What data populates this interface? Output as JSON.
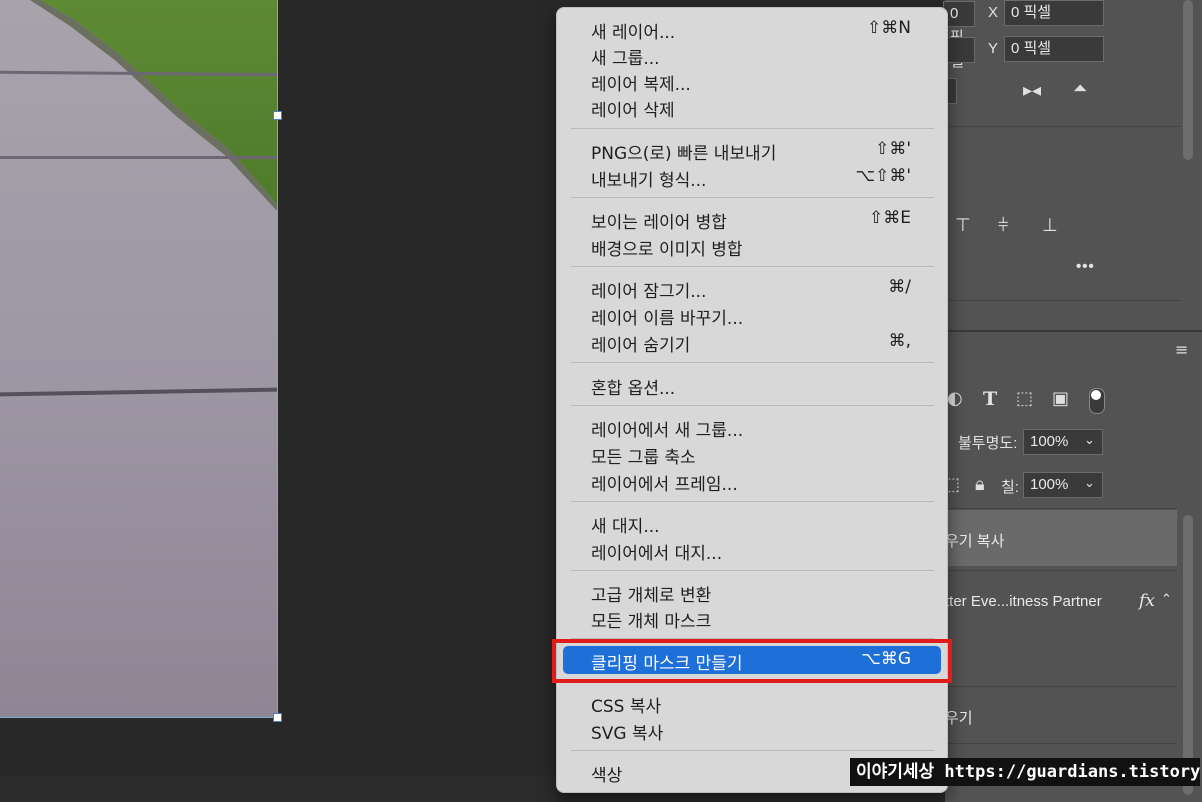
{
  "properties_panel": {
    "x_label": "X",
    "x_value": "0 픽셀",
    "y_label": "Y",
    "y_value": "0 픽셀",
    "partial_value_top": "0 픽셀",
    "more_label": "•••"
  },
  "layers_panel": {
    "opacity_label": "불투명도:",
    "opacity_value": "100%",
    "fill_label": "칠:",
    "fill_value": "100%",
    "layers": [
      {
        "name": "우기 복사",
        "selected": true
      },
      {
        "name": "tter Eve...itness Partner",
        "fx": "fx"
      },
      {
        "name": "우기"
      }
    ],
    "type_icon": "T"
  },
  "context_menu": {
    "groups": [
      [
        {
          "label": "새 레이어...",
          "shortcut": "⇧⌘N"
        },
        {
          "label": "새 그룹...",
          "shortcut": ""
        },
        {
          "label": "레이어 복제...",
          "shortcut": ""
        },
        {
          "label": "레이어 삭제",
          "shortcut": ""
        }
      ],
      [
        {
          "label": "PNG으(로) 빠른 내보내기",
          "shortcut": "⇧⌘'"
        },
        {
          "label": "내보내기 형식...",
          "shortcut": "⌥⇧⌘'"
        }
      ],
      [
        {
          "label": "보이는 레이어 병합",
          "shortcut": "⇧⌘E"
        },
        {
          "label": "배경으로 이미지 병합",
          "shortcut": ""
        }
      ],
      [
        {
          "label": "레이어 잠그기...",
          "shortcut": "⌘/"
        },
        {
          "label": "레이어 이름 바꾸기...",
          "shortcut": ""
        },
        {
          "label": "레이어 숨기기",
          "shortcut": "⌘,"
        }
      ],
      [
        {
          "label": "혼합 옵션...",
          "shortcut": ""
        }
      ],
      [
        {
          "label": "레이어에서 새 그룹...",
          "shortcut": ""
        },
        {
          "label": "모든 그룹 축소",
          "shortcut": ""
        },
        {
          "label": "레이어에서 프레임...",
          "shortcut": ""
        }
      ],
      [
        {
          "label": "새 대지...",
          "shortcut": ""
        },
        {
          "label": "레이어에서 대지...",
          "shortcut": ""
        }
      ],
      [
        {
          "label": "고급 개체로 변환",
          "shortcut": ""
        },
        {
          "label": "모든 개체 마스크",
          "shortcut": ""
        }
      ],
      [
        {
          "label": "클리핑 마스크 만들기",
          "shortcut": "⌥⌘G",
          "highlighted": true
        }
      ],
      [
        {
          "label": "CSS 복사",
          "shortcut": ""
        },
        {
          "label": "SVG 복사",
          "shortcut": ""
        }
      ],
      [
        {
          "label": "색상",
          "shortcut": ""
        }
      ]
    ]
  },
  "watermark": {
    "text": "이야기세상 https://guardians.tistory.com"
  },
  "colors": {
    "highlight": "#1f6fd9",
    "annotation_box": "#e21b1b",
    "menu_background": "#d8d8d8",
    "panel_background": "#535353"
  }
}
